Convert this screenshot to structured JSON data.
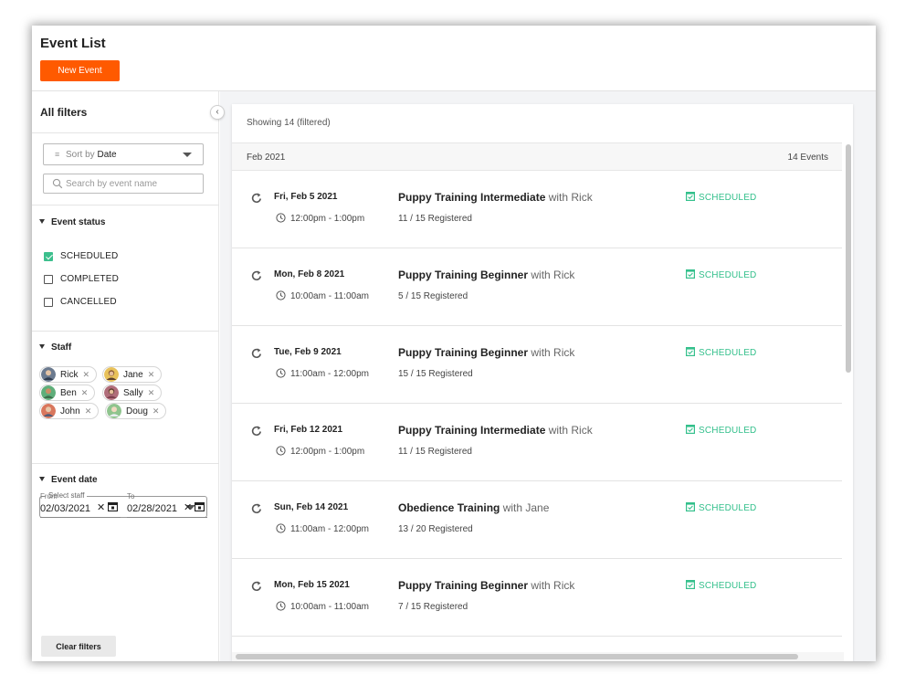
{
  "header": {
    "title": "Event List",
    "new_event_label": "New Event"
  },
  "sidebar": {
    "title": "All filters",
    "sort": {
      "prefix": "Sort by",
      "value": "Date"
    },
    "search_placeholder": "Search by event name",
    "event_status": {
      "heading": "Event status",
      "options": [
        {
          "label": "SCHEDULED",
          "checked": true
        },
        {
          "label": "COMPLETED",
          "checked": false
        },
        {
          "label": "CANCELLED",
          "checked": false
        }
      ]
    },
    "staff": {
      "heading": "Staff",
      "chips": [
        "Rick",
        "Jane",
        "Ben",
        "Sally",
        "John",
        "Doug"
      ],
      "select_label": "Select staff"
    },
    "event_date": {
      "heading": "Event date",
      "from_label": "From",
      "from_value": "02/03/2021",
      "to_label": "To",
      "to_value": "02/28/2021"
    },
    "clear_label": "Clear filters"
  },
  "list": {
    "showing": "Showing 14 (filtered)",
    "month": "Feb 2021",
    "count": "14 Events",
    "events": [
      {
        "date": "Fri, Feb 5 2021",
        "time": "12:00pm - 1:00pm",
        "name": "Puppy Training Intermediate",
        "with": "with Rick",
        "registered": "11 / 15 Registered",
        "status": "SCHEDULED"
      },
      {
        "date": "Mon, Feb 8 2021",
        "time": "10:00am - 11:00am",
        "name": "Puppy Training Beginner",
        "with": "with Rick",
        "registered": "5 / 15 Registered",
        "status": "SCHEDULED"
      },
      {
        "date": "Tue, Feb 9 2021",
        "time": "11:00am - 12:00pm",
        "name": "Puppy Training Beginner",
        "with": "with Rick",
        "registered": "15 / 15 Registered",
        "status": "SCHEDULED"
      },
      {
        "date": "Fri, Feb 12 2021",
        "time": "12:00pm - 1:00pm",
        "name": "Puppy Training Intermediate",
        "with": "with Rick",
        "registered": "11 / 15 Registered",
        "status": "SCHEDULED"
      },
      {
        "date": "Sun, Feb 14 2021",
        "time": "11:00am - 12:00pm",
        "name": "Obedience Training",
        "with": "with Jane",
        "registered": "13 / 20 Registered",
        "status": "SCHEDULED"
      },
      {
        "date": "Mon, Feb 15 2021",
        "time": "10:00am - 11:00am",
        "name": "Puppy Training Beginner",
        "with": "with Rick",
        "registered": "7 / 15 Registered",
        "status": "SCHEDULED"
      }
    ]
  },
  "colors": {
    "accent": "#ff5a00",
    "status": "#34c08c"
  }
}
